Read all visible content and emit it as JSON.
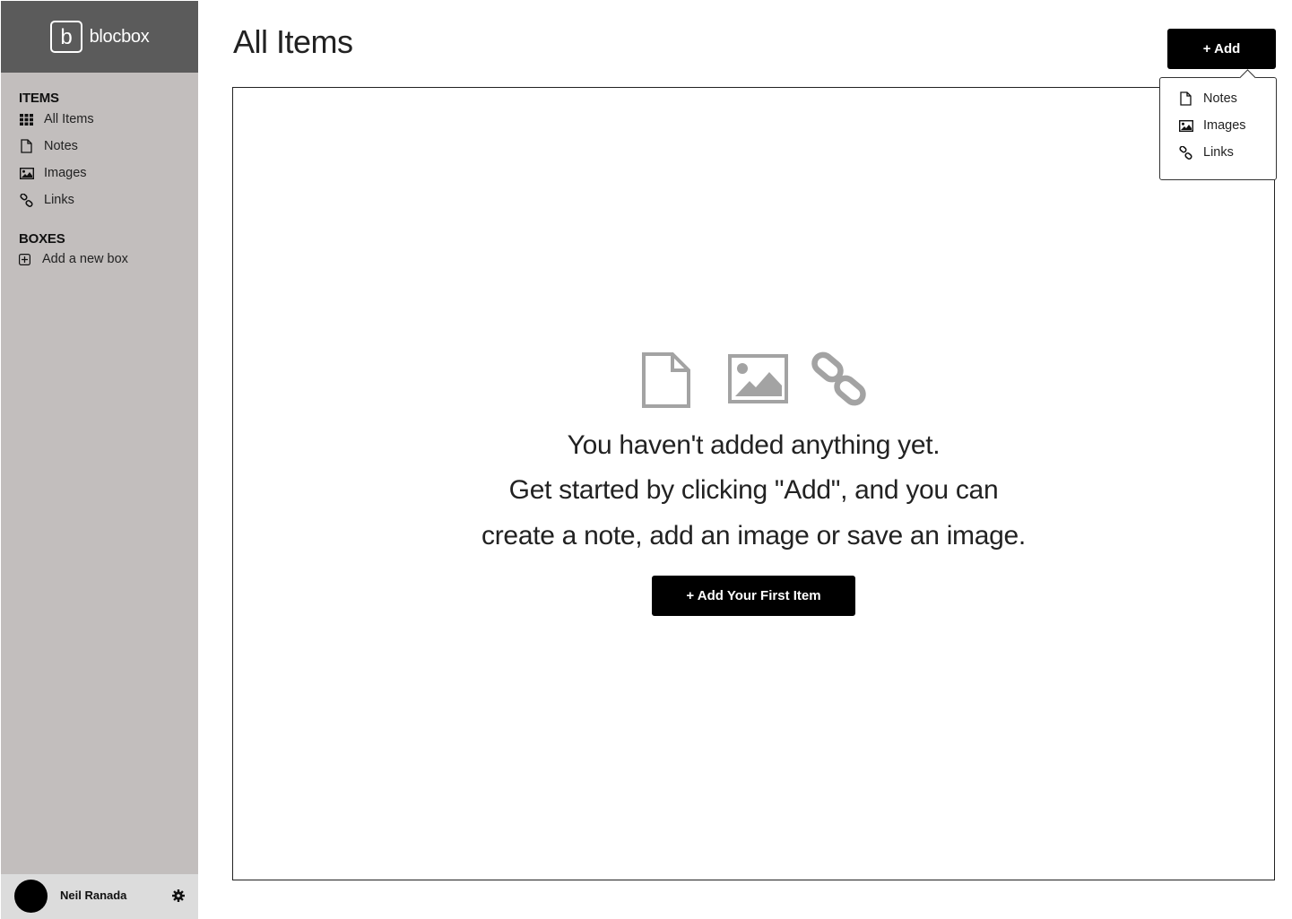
{
  "app": {
    "brand_letter": "b",
    "brand_name": "blocbox"
  },
  "sidebar": {
    "items_title": "ITEMS",
    "items": [
      {
        "label": "All Items",
        "icon": "grid-icon"
      },
      {
        "label": "Notes",
        "icon": "note-icon"
      },
      {
        "label": "Images",
        "icon": "image-icon"
      },
      {
        "label": "Links",
        "icon": "link-icon"
      }
    ],
    "boxes_title": "BOXES",
    "boxes": [
      {
        "label": "Add a new box",
        "icon": "plus-square-icon"
      }
    ]
  },
  "user": {
    "name": "Neil Ranada"
  },
  "header": {
    "title": "All Items",
    "add_label": "+ Add"
  },
  "add_menu": {
    "items": [
      {
        "label": "Notes",
        "icon": "note-icon"
      },
      {
        "label": "Images",
        "icon": "image-icon"
      },
      {
        "label": "Links",
        "icon": "link-icon"
      }
    ]
  },
  "empty_state": {
    "lines": [
      "You haven't added anything yet.",
      "Get started by clicking \"Add\", and you can",
      "create a note, add an image or save an image."
    ],
    "button_label": "+ Add Your First Item"
  },
  "colors": {
    "sidebar_bg": "#c2bebd",
    "brand_bg": "#5b5b5b",
    "profile_bg": "#dcdcdc",
    "button_bg": "#000000",
    "empty_icon": "#a3a3a3"
  }
}
